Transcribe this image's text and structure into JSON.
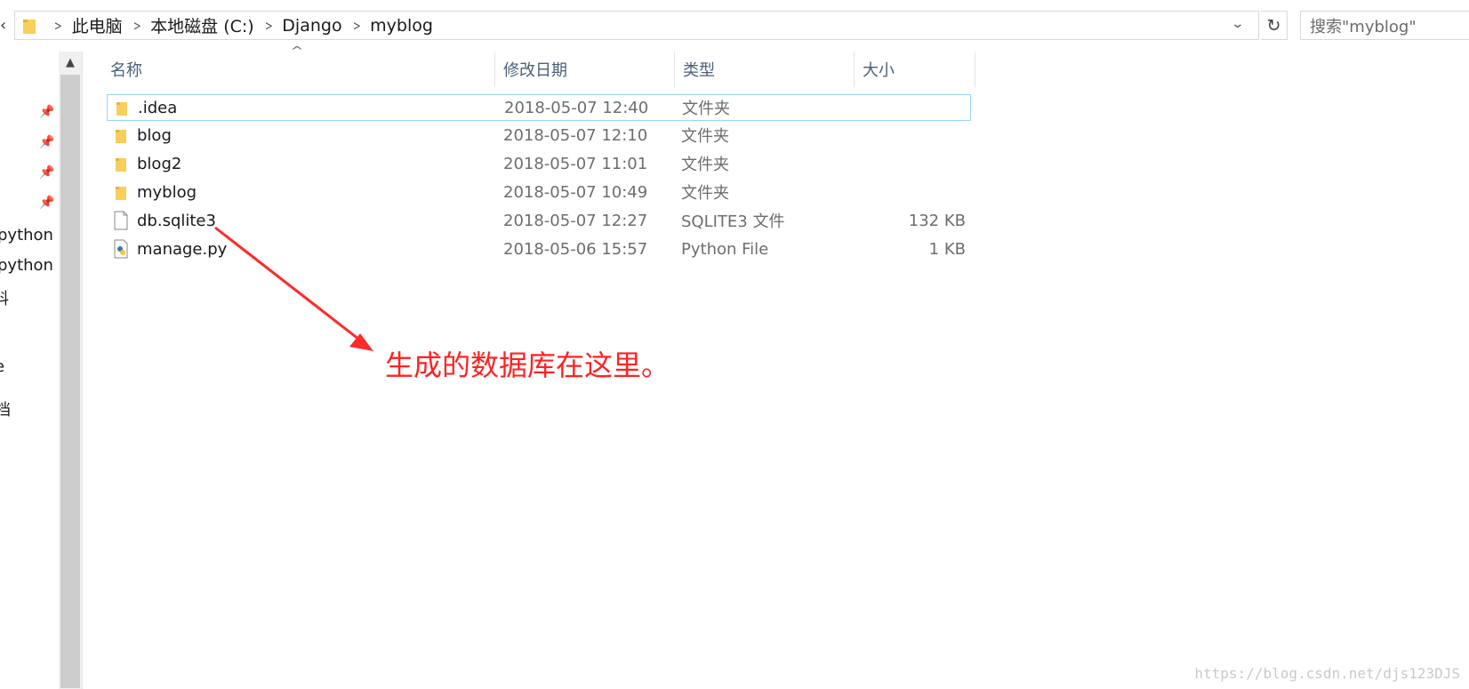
{
  "address_bar": {
    "breadcrumbs": [
      "此电脑",
      "本地磁盘 (C:)",
      "Django",
      "myblog"
    ],
    "refresh_glyph": "↻",
    "dropdown_glyph": "⌄"
  },
  "search": {
    "placeholder": "搜索\"myblog\""
  },
  "nav_pane": {
    "items": [
      "python",
      "python",
      "料",
      "e",
      "档"
    ]
  },
  "columns": {
    "name": "名称",
    "date": "修改日期",
    "type": "类型",
    "size": "大小"
  },
  "files": [
    {
      "name": ".idea",
      "date": "2018-05-07 12:40",
      "type": "文件夹",
      "size": "",
      "icon": "folder-icon",
      "selected": true
    },
    {
      "name": "blog",
      "date": "2018-05-07 12:10",
      "type": "文件夹",
      "size": "",
      "icon": "folder-icon"
    },
    {
      "name": "blog2",
      "date": "2018-05-07 11:01",
      "type": "文件夹",
      "size": "",
      "icon": "folder-icon"
    },
    {
      "name": "myblog",
      "date": "2018-05-07 10:49",
      "type": "文件夹",
      "size": "",
      "icon": "folder-icon"
    },
    {
      "name": "db.sqlite3",
      "date": "2018-05-07 12:27",
      "type": "SQLITE3 文件",
      "size": "132 KB",
      "icon": "file-icon"
    },
    {
      "name": "manage.py",
      "date": "2018-05-06 15:57",
      "type": "Python File",
      "size": "1 KB",
      "icon": "python-file-icon"
    }
  ],
  "annotation": {
    "text": "生成的数据库在这里。",
    "color": "#ff2222"
  },
  "watermark": "https://blog.csdn.net/djs123DJS",
  "colors": {
    "selection_border": "#99d1ff",
    "header_text": "#4c607a",
    "folder": "#f8cf5c"
  }
}
